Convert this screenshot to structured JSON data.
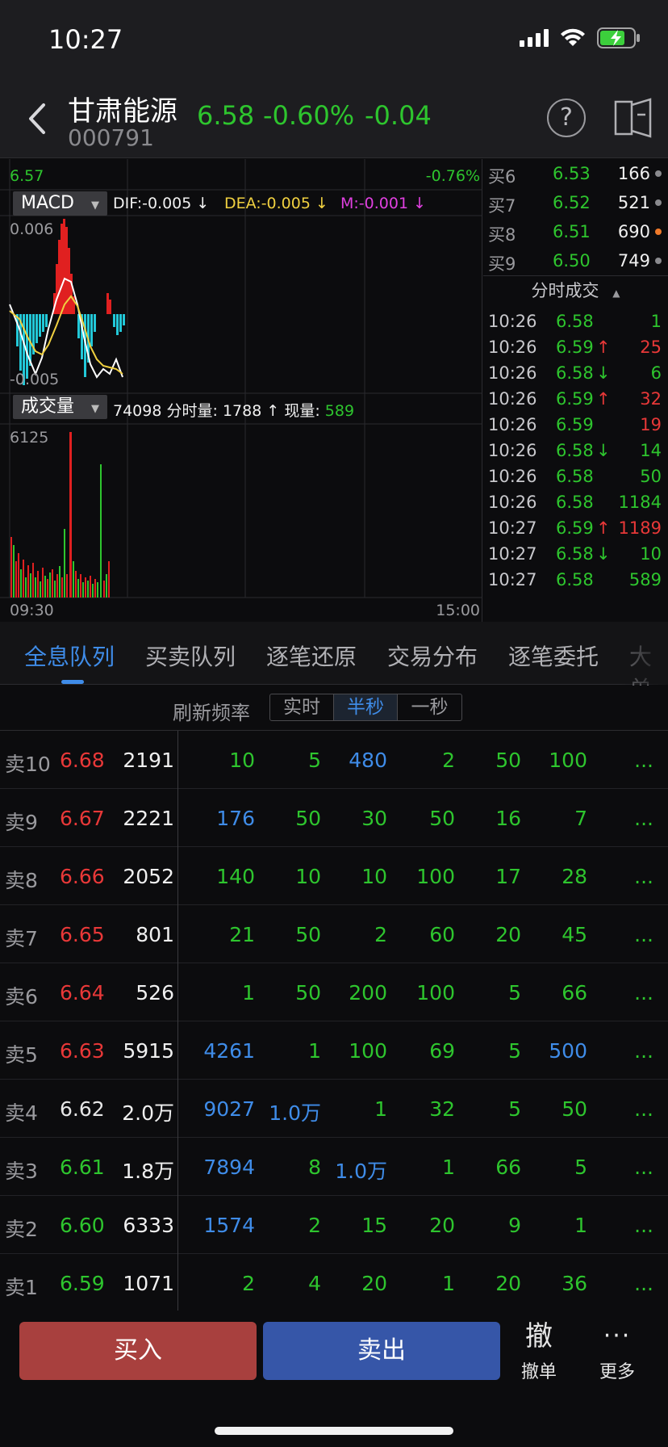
{
  "status": {
    "time": "10:27"
  },
  "header": {
    "name": "甘肃能源",
    "code": "000791",
    "price": "6.58",
    "change_pct": "-0.60%",
    "change": "-0.04",
    "help_label": "?"
  },
  "chart": {
    "top_left_price": "6.57",
    "top_right_pct": "-0.76%",
    "macd": {
      "selector": "MACD",
      "dif": "DIF:-0.005 ↓",
      "dea": "DEA:-0.005 ↓",
      "m": "M:-0.001 ↓",
      "max": "0.006",
      "min": "-0.005"
    },
    "volume": {
      "selector": "成交量",
      "total": "74098",
      "label_fs": "分时量:",
      "fs_value": "1788 ↑",
      "label_now": "现量:",
      "now_value": "589",
      "max": "6125"
    },
    "time_start": "09:30",
    "time_end": "15:00"
  },
  "order_book": [
    {
      "label": "买6",
      "price": "6.53",
      "vol": "166",
      "dot": "#8a8a8e"
    },
    {
      "label": "买7",
      "price": "6.52",
      "vol": "521",
      "dot": "#8a8a8e"
    },
    {
      "label": "买8",
      "price": "6.51",
      "vol": "690",
      "dot": "#f07a2a"
    },
    {
      "label": "买9",
      "price": "6.50",
      "vol": "749",
      "dot": "#8a8a8e"
    }
  ],
  "trades_title": "分时成交",
  "trades": [
    {
      "time": "10:26",
      "price": "6.58",
      "arrow": "",
      "vol": "1",
      "vcolor": "#2ec52e"
    },
    {
      "time": "10:26",
      "price": "6.59",
      "arrow": "↑",
      "vol": "25",
      "vcolor": "#e83838"
    },
    {
      "time": "10:26",
      "price": "6.58",
      "arrow": "↓",
      "vol": "6",
      "vcolor": "#2ec52e"
    },
    {
      "time": "10:26",
      "price": "6.59",
      "arrow": "↑",
      "vol": "32",
      "vcolor": "#e83838"
    },
    {
      "time": "10:26",
      "price": "6.59",
      "arrow": "",
      "vol": "19",
      "vcolor": "#e83838"
    },
    {
      "time": "10:26",
      "price": "6.58",
      "arrow": "↓",
      "vol": "14",
      "vcolor": "#2ec52e"
    },
    {
      "time": "10:26",
      "price": "6.58",
      "arrow": "",
      "vol": "50",
      "vcolor": "#2ec52e"
    },
    {
      "time": "10:26",
      "price": "6.58",
      "arrow": "",
      "vol": "1184",
      "vcolor": "#2ec52e"
    },
    {
      "time": "10:27",
      "price": "6.59",
      "arrow": "↑",
      "vol": "1189",
      "vcolor": "#e83838"
    },
    {
      "time": "10:27",
      "price": "6.58",
      "arrow": "↓",
      "vol": "10",
      "vcolor": "#2ec52e"
    },
    {
      "time": "10:27",
      "price": "6.58",
      "arrow": "",
      "vol": "589",
      "vcolor": "#2ec52e"
    }
  ],
  "tabs": [
    "全息队列",
    "买卖队列",
    "逐笔还原",
    "交易分布",
    "逐笔委托",
    "大单"
  ],
  "refresh": {
    "label": "刷新频率",
    "options": [
      "实时",
      "半秒",
      "一秒"
    ],
    "active": 1
  },
  "queue": [
    {
      "label": "卖10",
      "price": "6.68",
      "pcolor": "#e83838",
      "total": "2191",
      "orders": [
        [
          "10",
          "g"
        ],
        [
          "5",
          "g"
        ],
        [
          "480",
          "b"
        ],
        [
          "2",
          "g"
        ],
        [
          "50",
          "g"
        ],
        [
          "100",
          "g"
        ]
      ]
    },
    {
      "label": "卖9",
      "price": "6.67",
      "pcolor": "#e83838",
      "total": "2221",
      "orders": [
        [
          "176",
          "b"
        ],
        [
          "50",
          "g"
        ],
        [
          "30",
          "g"
        ],
        [
          "50",
          "g"
        ],
        [
          "16",
          "g"
        ],
        [
          "7",
          "g"
        ]
      ]
    },
    {
      "label": "卖8",
      "price": "6.66",
      "pcolor": "#e83838",
      "total": "2052",
      "orders": [
        [
          "140",
          "g"
        ],
        [
          "10",
          "g"
        ],
        [
          "10",
          "g"
        ],
        [
          "100",
          "g"
        ],
        [
          "17",
          "g"
        ],
        [
          "28",
          "g"
        ]
      ]
    },
    {
      "label": "卖7",
      "price": "6.65",
      "pcolor": "#e83838",
      "total": "801",
      "orders": [
        [
          "21",
          "g"
        ],
        [
          "50",
          "g"
        ],
        [
          "2",
          "g"
        ],
        [
          "60",
          "g"
        ],
        [
          "20",
          "g"
        ],
        [
          "45",
          "g"
        ]
      ]
    },
    {
      "label": "卖6",
      "price": "6.64",
      "pcolor": "#e83838",
      "total": "526",
      "orders": [
        [
          "1",
          "g"
        ],
        [
          "50",
          "g"
        ],
        [
          "200",
          "g"
        ],
        [
          "100",
          "g"
        ],
        [
          "5",
          "g"
        ],
        [
          "66",
          "g"
        ]
      ]
    },
    {
      "label": "卖5",
      "price": "6.63",
      "pcolor": "#e83838",
      "total": "5915",
      "orders": [
        [
          "4261",
          "b"
        ],
        [
          "1",
          "g"
        ],
        [
          "100",
          "g"
        ],
        [
          "69",
          "g"
        ],
        [
          "5",
          "g"
        ],
        [
          "500",
          "b"
        ]
      ]
    },
    {
      "label": "卖4",
      "price": "6.62",
      "pcolor": "#e6e6e6",
      "total": "2.0万",
      "orders": [
        [
          "9027",
          "b"
        ],
        [
          "1.0万",
          "b"
        ],
        [
          "1",
          "g"
        ],
        [
          "32",
          "g"
        ],
        [
          "5",
          "g"
        ],
        [
          "50",
          "g"
        ]
      ]
    },
    {
      "label": "卖3",
      "price": "6.61",
      "pcolor": "#2ec52e",
      "total": "1.8万",
      "orders": [
        [
          "7894",
          "b"
        ],
        [
          "8",
          "g"
        ],
        [
          "1.0万",
          "b"
        ],
        [
          "1",
          "g"
        ],
        [
          "66",
          "g"
        ],
        [
          "5",
          "g"
        ]
      ]
    },
    {
      "label": "卖2",
      "price": "6.60",
      "pcolor": "#2ec52e",
      "total": "6333",
      "orders": [
        [
          "1574",
          "b"
        ],
        [
          "2",
          "g"
        ],
        [
          "15",
          "g"
        ],
        [
          "20",
          "g"
        ],
        [
          "9",
          "g"
        ],
        [
          "1",
          "g"
        ]
      ]
    },
    {
      "label": "卖1",
      "price": "6.59",
      "pcolor": "#2ec52e",
      "total": "1071",
      "orders": [
        [
          "2",
          "g"
        ],
        [
          "4",
          "g"
        ],
        [
          "20",
          "g"
        ],
        [
          "1",
          "g"
        ],
        [
          "20",
          "g"
        ],
        [
          "36",
          "g"
        ]
      ]
    }
  ],
  "queue_more": "...",
  "actions": {
    "buy": "买入",
    "sell": "卖出",
    "cancel_icon": "撤",
    "cancel": "撤单",
    "more_icon": "···",
    "more": "更多"
  },
  "colors": {
    "up": "#e83838",
    "down": "#2ec52e",
    "blue": "#3f8ce8",
    "yellow": "#f0d040",
    "magenta": "#e040e0"
  }
}
